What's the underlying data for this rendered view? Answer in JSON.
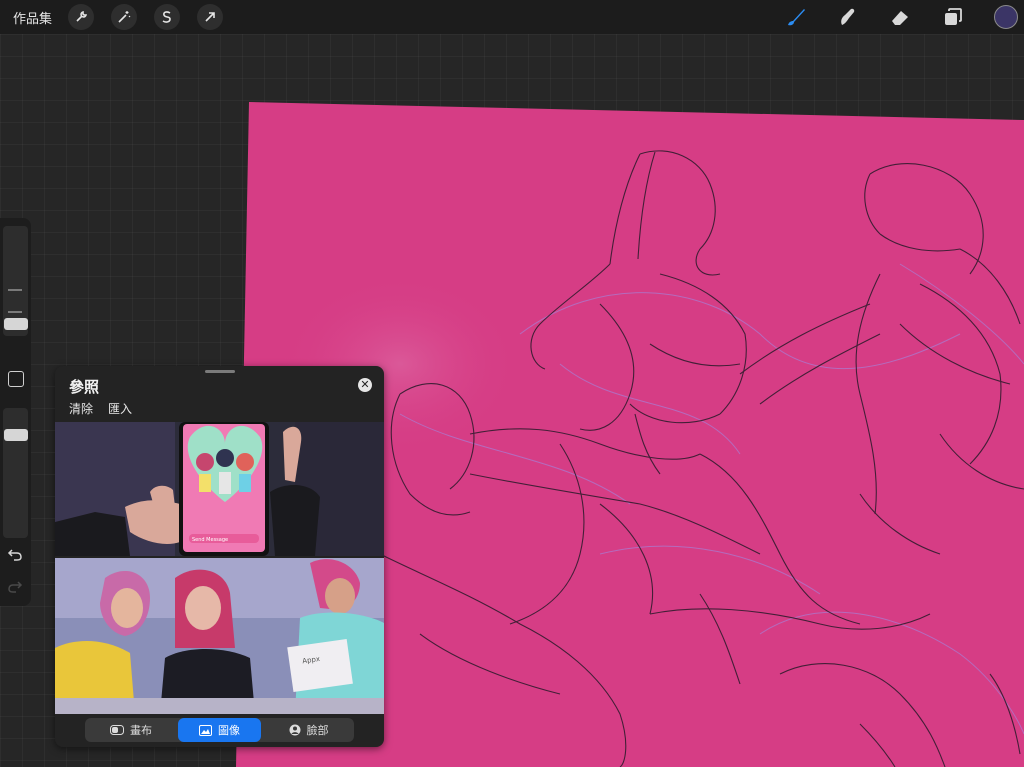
{
  "topbar": {
    "gallery_label": "作品集",
    "left_tools": [
      "wrench-icon",
      "magic-wand-icon",
      "selection-icon",
      "transform-arrow-icon"
    ],
    "right_tools": [
      "brush-icon",
      "smudge-icon",
      "eraser-icon",
      "layers-icon"
    ],
    "color_swatch": "#3b3566"
  },
  "canvas": {
    "background": "#d63d85",
    "sketch_color": "#2a1a2a",
    "construction_color": "#a77fd6"
  },
  "sidebar": {
    "brush_size_fraction": 0.25,
    "opacity_fraction": 0.25,
    "items": [
      "brush-size-slider",
      "modify-button",
      "opacity-slider",
      "undo-icon",
      "redo-icon"
    ]
  },
  "reference": {
    "title": "參照",
    "clear_label": "清除",
    "import_label": "匯入",
    "phone_message_placeholder": "Send Message",
    "note_text": "Appx",
    "tabs": [
      {
        "label": "畫布",
        "active": false
      },
      {
        "label": "圖像",
        "active": true
      },
      {
        "label": "臉部",
        "active": false
      }
    ]
  }
}
